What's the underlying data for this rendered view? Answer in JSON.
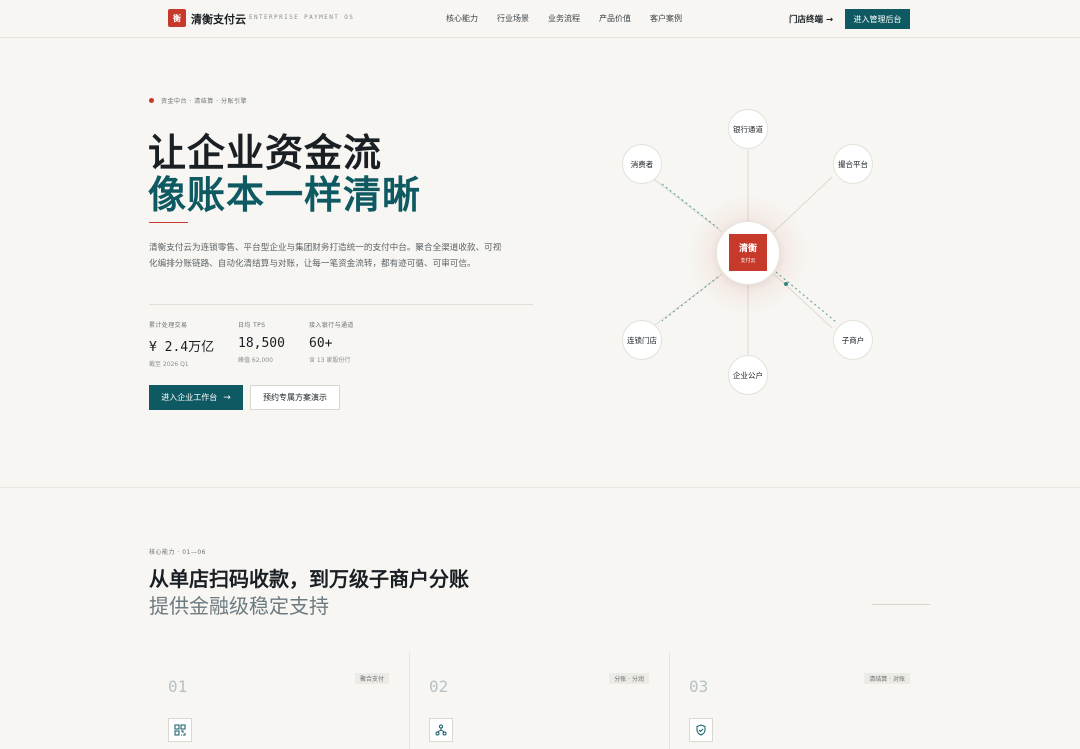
{
  "nav": {
    "logo_char": "衡",
    "brand": "清衡支付云",
    "brand_sub": "ENTERPRISE PAYMENT OS",
    "links": [
      "核心能力",
      "行业场景",
      "业务流程",
      "产品价值",
      "客户案例"
    ],
    "store_link": "门店终端 →",
    "admin_button": "进入管理后台"
  },
  "hero": {
    "eyebrow": "资金中台 · 清结算 · 分账引擎",
    "title_line1": "让企业资金流",
    "title_line2": "像账本一样清晰",
    "description": "清衡支付云为连锁零售、平台型企业与集团财务打造统一的支付中台。聚合全渠道收款、可视化编排分账链路、自动化清结算与对账，让每一笔资金流转，都有迹可循、可审可信。",
    "stats": [
      {
        "label": "累计处理交易",
        "value": "¥ 2.4万亿",
        "sub": "截至 2026 Q1"
      },
      {
        "label": "日均 TPS",
        "value": "18,500",
        "sub": "峰值 62,000"
      },
      {
        "label": "接入银行与通道",
        "value": "60+",
        "sub": "含 13 家股份行"
      }
    ],
    "primary_button": "进入企业工作台",
    "secondary_button": "预约专属方案演示"
  },
  "diagram": {
    "center_title": "清衡",
    "center_sub": "支付云",
    "nodes": {
      "bank": "银行通道",
      "consumer": "消费者",
      "platform": "撮合平台",
      "chain": "连锁门店",
      "merchant": "子商户",
      "corporate": "企业公户"
    }
  },
  "section": {
    "eyebrow": "核心能力 · 01—06",
    "title_line1": "从单店扫码收款，到万级子商户分账",
    "title_line2": "提供金融级稳定支持",
    "cards": [
      {
        "num": "01",
        "tag": "聚合支付",
        "icon": "qr-code-icon"
      },
      {
        "num": "02",
        "tag": "分账 · 分润",
        "icon": "split-tree-icon"
      },
      {
        "num": "03",
        "tag": "清结算 · 对账",
        "icon": "shield-check-icon"
      }
    ]
  },
  "colors": {
    "brand_red": "#c6392b",
    "brand_teal": "#0f5a62",
    "background": "#f7f6f2"
  }
}
